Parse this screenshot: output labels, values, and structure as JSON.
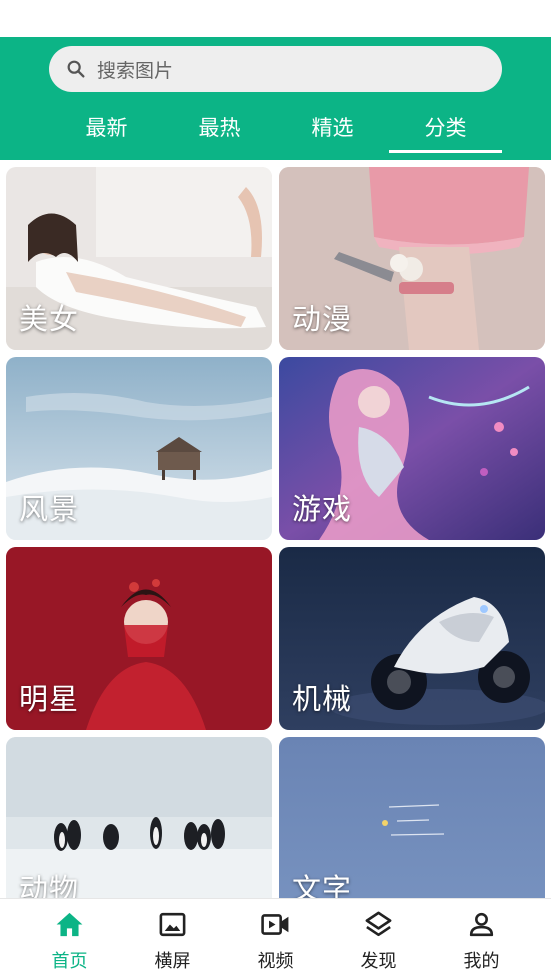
{
  "search": {
    "placeholder": "搜索图片",
    "icon": "search-icon"
  },
  "tabs": [
    {
      "label": "最新"
    },
    {
      "label": "最热"
    },
    {
      "label": "精选"
    },
    {
      "label": "分类",
      "selected": true
    }
  ],
  "categories": [
    {
      "label": "美女"
    },
    {
      "label": "动漫"
    },
    {
      "label": "风景"
    },
    {
      "label": "游戏"
    },
    {
      "label": "明星"
    },
    {
      "label": "机械"
    },
    {
      "label": "动物"
    },
    {
      "label": "文字"
    }
  ],
  "bottom_nav": [
    {
      "label": "首页",
      "icon": "home-icon",
      "active": true
    },
    {
      "label": "横屏",
      "icon": "image-icon"
    },
    {
      "label": "视频",
      "icon": "video-icon"
    },
    {
      "label": "发现",
      "icon": "layers-icon"
    },
    {
      "label": "我的",
      "icon": "person-icon"
    }
  ],
  "colors": {
    "accent": "#0cb486",
    "inactive_nav": "#222222",
    "search_bg": "#eeeeee"
  }
}
